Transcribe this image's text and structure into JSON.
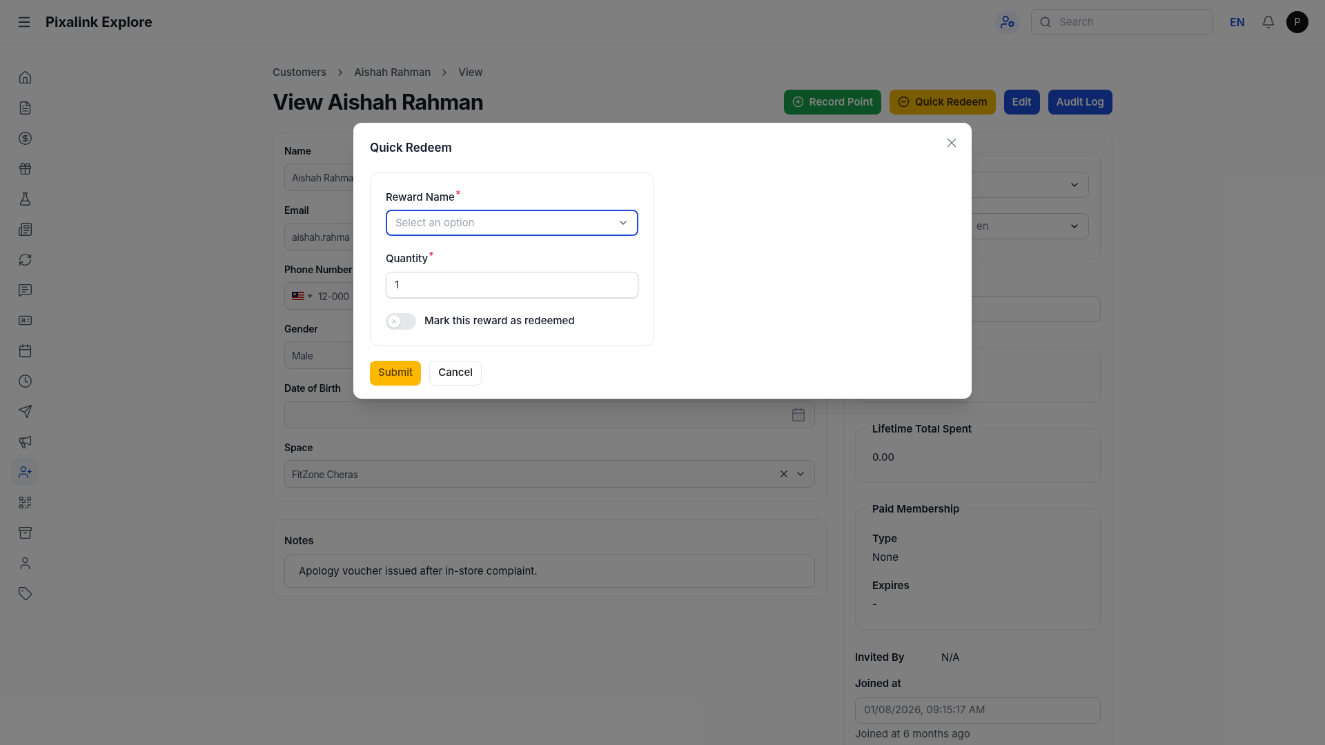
{
  "app": {
    "title": "Pixalink Explore"
  },
  "header": {
    "search": {
      "placeholder": "Search"
    },
    "language": "EN",
    "avatar": "P"
  },
  "sidebar": {
    "items": [
      {
        "selected": false
      },
      {
        "selected": false
      },
      {
        "selected": false
      },
      {
        "selected": false
      },
      {
        "selected": false
      },
      {
        "selected": false
      },
      {
        "selected": false
      },
      {
        "selected": false
      },
      {
        "selected": false
      },
      {
        "selected": false
      },
      {
        "selected": false
      },
      {
        "selected": false
      },
      {
        "selected": false
      },
      {
        "selected": true
      },
      {
        "selected": false
      },
      {
        "selected": false
      },
      {
        "selected": false
      },
      {
        "selected": false
      }
    ]
  },
  "breadcrumb": [
    "Customers",
    "Aishah Rahman",
    "View"
  ],
  "page_title": "View Aishah Rahman",
  "actions": [
    {
      "label": "Record Point",
      "kind": "success"
    },
    {
      "label": "Quick Redeem",
      "kind": "warning"
    },
    {
      "label": "Edit",
      "kind": "primary"
    },
    {
      "label": "Audit Log",
      "kind": "primary"
    }
  ],
  "form": {
    "fields": [
      {
        "label": "Name",
        "value": "Aishah Rahma",
        "kind": "text"
      },
      {
        "label": "Email",
        "value": "aishah.rahma",
        "kind": "text"
      },
      {
        "label": "Phone Number",
        "value": "12-000",
        "kind": "phone"
      },
      {
        "label": "Gender",
        "value": "Male",
        "kind": "text"
      },
      {
        "label": "Date of Birth",
        "kind": "date"
      },
      {
        "label": "Space",
        "value": "FitZone Cheras",
        "kind": "select"
      }
    ]
  },
  "notes": {
    "label": "Notes",
    "value": "Apology voucher issued after in-store complaint."
  },
  "side_panel": {
    "select_value": "en",
    "lifetime_total_spent": {
      "label": "Lifetime Total Spent",
      "value": "0.00"
    },
    "paid_membership": {
      "label": "Paid Membership",
      "fields": [
        {
          "label": "Type",
          "value": "None"
        },
        {
          "label": "Expires",
          "value": "-"
        }
      ]
    },
    "invited_by": {
      "label": "Invited By",
      "value": "N/A"
    },
    "joined_at": {
      "label": "Joined at",
      "value": "01/08/2026, 09:15:17 AM",
      "note": "Joined at 6 months ago"
    }
  },
  "modal": {
    "title": "Quick Redeem",
    "fields": [
      {
        "label": "Reward Name",
        "required": true,
        "placeholder": "Select an option",
        "kind": "select",
        "focused": true
      },
      {
        "label": "Quantity",
        "required": true,
        "value": "1",
        "kind": "number",
        "focused": false
      }
    ],
    "toggle": {
      "label": "Mark this reward as redeemed",
      "on": false
    },
    "buttons": [
      {
        "label": "Submit",
        "kind": "primary"
      },
      {
        "label": "Cancel",
        "kind": "secondary"
      }
    ]
  }
}
